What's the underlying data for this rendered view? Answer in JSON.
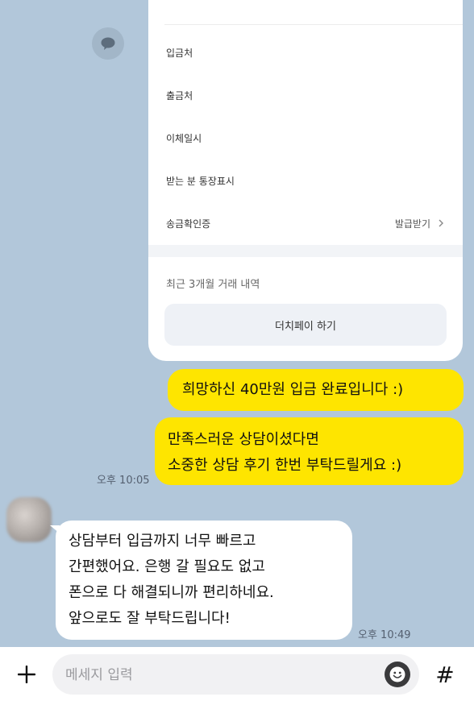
{
  "card": {
    "rows": [
      {
        "label": "입금처",
        "value": ""
      },
      {
        "label": "출금처",
        "value": ""
      },
      {
        "label": "이체일시",
        "value": ""
      },
      {
        "label": "받는 분 통장표시",
        "value": ""
      },
      {
        "label": "송금확인증",
        "value": "발급받기"
      }
    ],
    "recent_label": "최근 3개월 거래 내역",
    "dutch_button": "더치페이 하기"
  },
  "messages": [
    {
      "sender": "me",
      "lines": [
        "희망하신 40만원 입금 완료입니다 :)"
      ]
    },
    {
      "sender": "me",
      "lines": [
        "만족스러운 상담이셨다면",
        "소중한 상담 후기 한번 부탁드릴게요 :)"
      ],
      "time": "오후 10:05"
    },
    {
      "sender": "other",
      "lines": [
        "상담부터 입금까지 너무 빠르고",
        "간편했어요. 은행 갈 필요도 없고",
        "폰으로 다 해결되니까 편리하네요.",
        "앞으로도 잘 부탁드립니다!"
      ],
      "time": "오후 10:49"
    }
  ],
  "input": {
    "placeholder": "메세지 입력",
    "hash": "#"
  },
  "colors": {
    "background": "#b2c7da",
    "my_bubble": "#fee500",
    "other_bubble": "#ffffff"
  }
}
